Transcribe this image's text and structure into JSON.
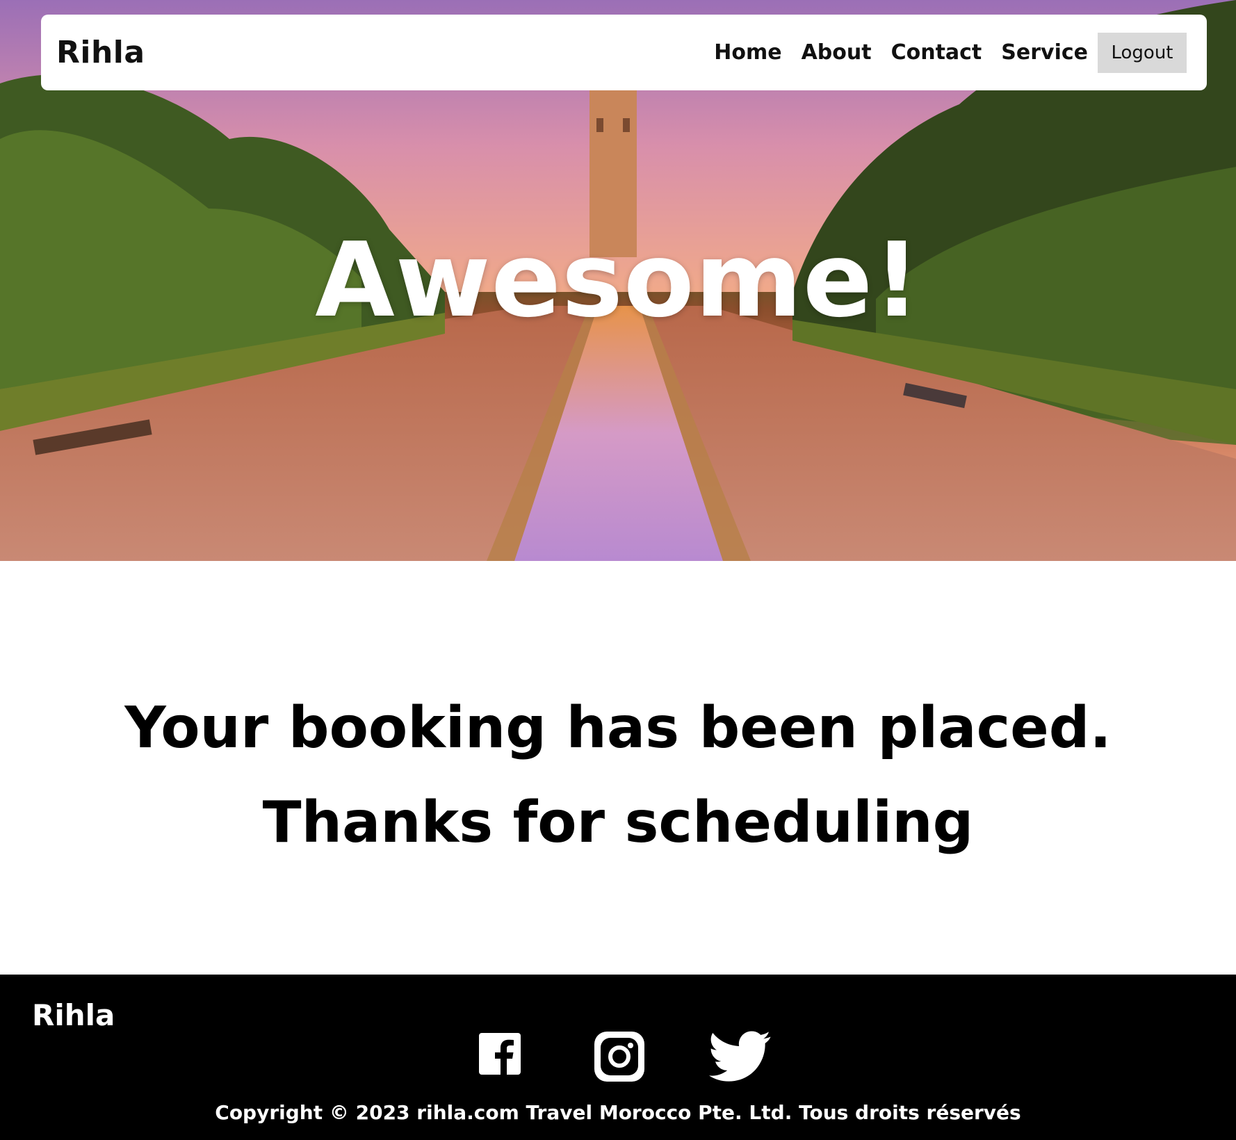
{
  "nav": {
    "brand": "Rihla",
    "links": [
      "Home",
      "About",
      "Contact",
      "Service"
    ],
    "logout_label": "Logout"
  },
  "hero": {
    "title": "Awesome!"
  },
  "message": {
    "line1": "Your booking has been placed.",
    "line2": "Thanks for scheduling"
  },
  "footer": {
    "brand": "Rihla",
    "socials": [
      "facebook-icon",
      "instagram-icon",
      "twitter-icon"
    ],
    "copyright": "Copyright © 2023 rihla.com Travel Morocco Pte. Ltd. Tous droits réservés"
  },
  "colors": {
    "nav_bg": "#ffffff",
    "logout_bg": "#d9d9d9",
    "footer_bg": "#000000",
    "text": "#000000"
  }
}
